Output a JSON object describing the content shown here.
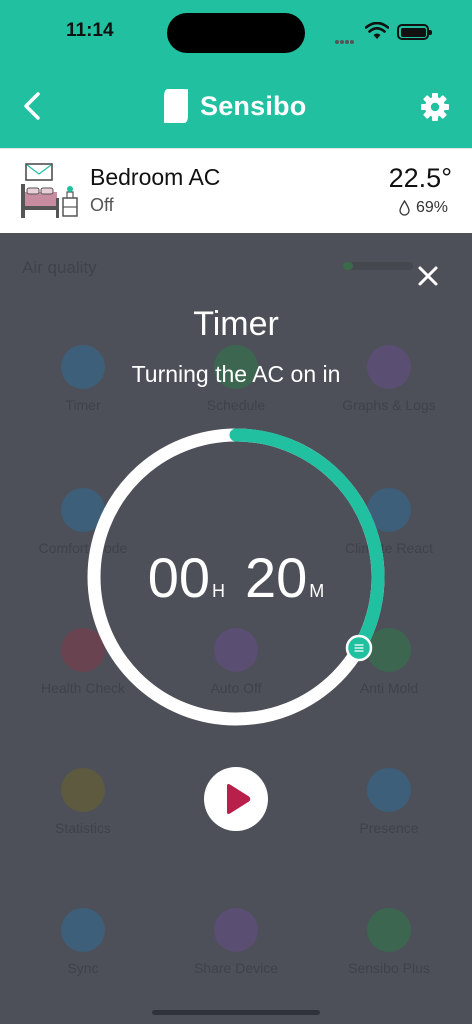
{
  "status_bar": {
    "time": "11:14"
  },
  "nav": {
    "brand": "Sensibo"
  },
  "device": {
    "name": "Bedroom AC",
    "state": "Off",
    "temperature": "22.5°",
    "humidity": "69%"
  },
  "background": {
    "air_quality_label": "Air quality",
    "features": [
      {
        "label": "Timer"
      },
      {
        "label": "Schedule"
      },
      {
        "label": "Graphs & Logs"
      },
      {
        "label": "Comfort Mode"
      },
      {
        "label": "Climate React"
      },
      {
        "label": "Health Check"
      },
      {
        "label": "Auto Off"
      },
      {
        "label": "Anti Mold"
      },
      {
        "label": "Statistics"
      },
      {
        "label": "Presence"
      },
      {
        "label": "Sync"
      },
      {
        "label": "Share Device"
      },
      {
        "label": "Sensibo Plus"
      }
    ]
  },
  "timer": {
    "title": "Timer",
    "subtitle": "Turning the AC on in",
    "hours": "00",
    "hours_unit": "H",
    "minutes": "20",
    "minutes_unit": "M",
    "progress_fraction": 0.3333,
    "ring_color": "#21c0a0"
  },
  "colors": {
    "accent": "#21c0a0",
    "play": "#b81f4b"
  }
}
